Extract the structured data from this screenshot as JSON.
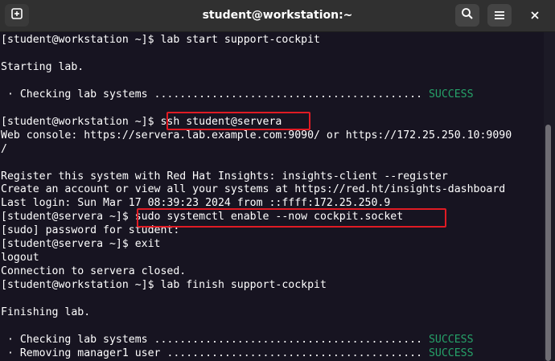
{
  "window": {
    "title": "student@workstation:~",
    "new_tab_icon": "new-tab-icon",
    "search_icon": "search-icon",
    "menu_icon": "hamburger-menu-icon",
    "close_icon": "close-icon"
  },
  "colors": {
    "background": "#171421",
    "titlebar": "#303030",
    "text": "#ffffff",
    "success": "#26a269",
    "highlight": "#e01b24"
  },
  "terminal": {
    "lines": [
      {
        "text": "[student@workstation ~]$ lab start support-cockpit"
      },
      {
        "text": ""
      },
      {
        "text": "Starting lab."
      },
      {
        "text": ""
      },
      {
        "text": " · Checking lab systems .......................................... ",
        "status": "SUCCESS"
      },
      {
        "text": ""
      },
      {
        "text": "[student@workstation ~]$ ssh student@servera"
      },
      {
        "text": "Web console: https://servera.lab.example.com:9090/ or https://172.25.250.10:9090"
      },
      {
        "text": "/"
      },
      {
        "text": ""
      },
      {
        "text": "Register this system with Red Hat Insights: insights-client --register"
      },
      {
        "text": "Create an account or view all your systems at https://red.ht/insights-dashboard"
      },
      {
        "text": "Last login: Sun Mar 17 08:39:23 2024 from ::ffff:172.25.250.9"
      },
      {
        "text": "[student@servera ~]$ sudo systemctl enable --now cockpit.socket"
      },
      {
        "text": "[sudo] password for student:"
      },
      {
        "text": "[student@servera ~]$ exit"
      },
      {
        "text": "logout"
      },
      {
        "text": "Connection to servera closed."
      },
      {
        "text": "[student@workstation ~]$ lab finish support-cockpit"
      },
      {
        "text": ""
      },
      {
        "text": "Finishing lab."
      },
      {
        "text": ""
      },
      {
        "text": " · Checking lab systems .......................................... ",
        "status": "SUCCESS"
      },
      {
        "text": " · Removing manager1 user ........................................ ",
        "status": "SUCCESS"
      }
    ]
  }
}
